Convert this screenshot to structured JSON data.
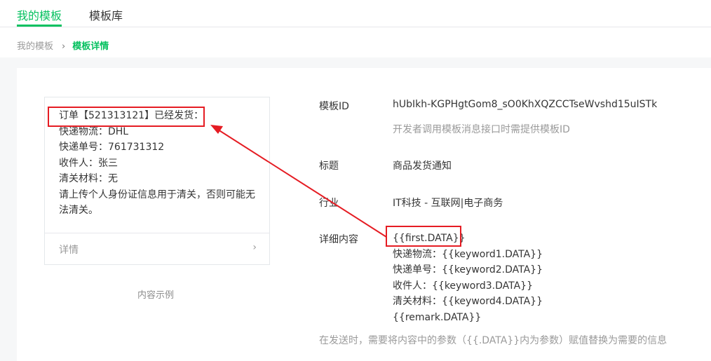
{
  "tabs": [
    {
      "label": "我的模板",
      "active": true
    },
    {
      "label": "模板库",
      "active": false
    }
  ],
  "breadcrumb": {
    "root": "我的模板",
    "current": "模板详情"
  },
  "preview": {
    "lines": [
      "订单【521313121】已经发货：",
      "快递物流：DHL",
      "快递单号：761731312",
      "收件人：张三",
      "清关材料：无",
      "请上传个人身份证信息用于清关，否则可能无法清关。"
    ],
    "detail_label": "详情",
    "caption": "内容示例"
  },
  "fields": {
    "template_id": {
      "label": "模板ID",
      "value": "hUbIkh-KGPHgtGom8_sO0KhXQZCCTseWvshd15uISTk",
      "hint": "开发者调用模板消息接口时需提供模板ID"
    },
    "title": {
      "label": "标题",
      "value": "商品发货通知"
    },
    "industry": {
      "label": "行业",
      "value": "IT科技 - 互联网|电子商务"
    },
    "content": {
      "label": "详细内容",
      "lines": [
        "{{first.DATA}}",
        "快递物流：{{keyword1.DATA}}",
        "快递单号：{{keyword2.DATA}}",
        "收件人：{{keyword3.DATA}}",
        "清关材料：{{keyword4.DATA}}",
        "{{remark.DATA}}"
      ],
      "note": "在发送时，需要将内容中的参数（{{.DATA}}内为参数）赋值替换为需要的信息"
    }
  },
  "colors": {
    "accent": "#07c160",
    "annotation": "#e51c23",
    "background": "#f6f7f8"
  },
  "icons": {
    "detail_chevron": "chevron-right-icon",
    "breadcrumb_separator": "chevron-right-icon"
  }
}
